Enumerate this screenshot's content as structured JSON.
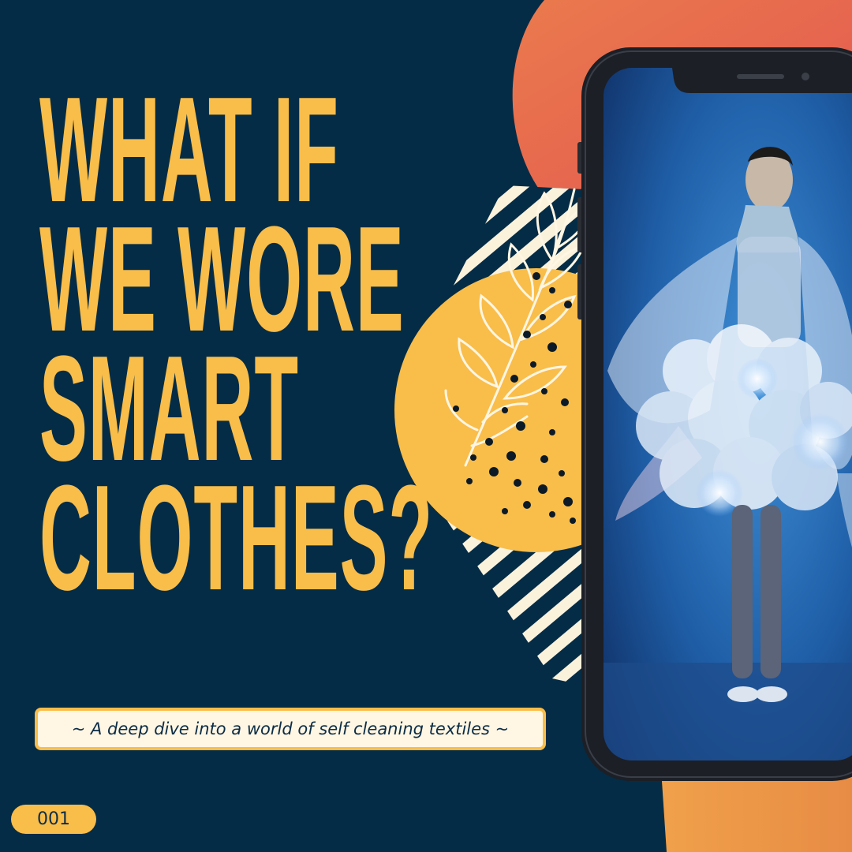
{
  "headline": {
    "lines": [
      "WHAT IF",
      "WE WORE",
      "SMART",
      "CLOTHES?"
    ]
  },
  "subtitle": "~ A deep dive into a world of self cleaning textiles ~",
  "issue_number": "001",
  "colors": {
    "background": "#042c46",
    "accent_yellow": "#f9bd4a",
    "accent_orange": "#e66a4d",
    "stripe_cream": "#fbf2dc",
    "phone_frame": "#1c1f26"
  },
  "icons": {
    "phone": "smartphone-mockup",
    "leaf": "leaf-branch-doodle"
  }
}
